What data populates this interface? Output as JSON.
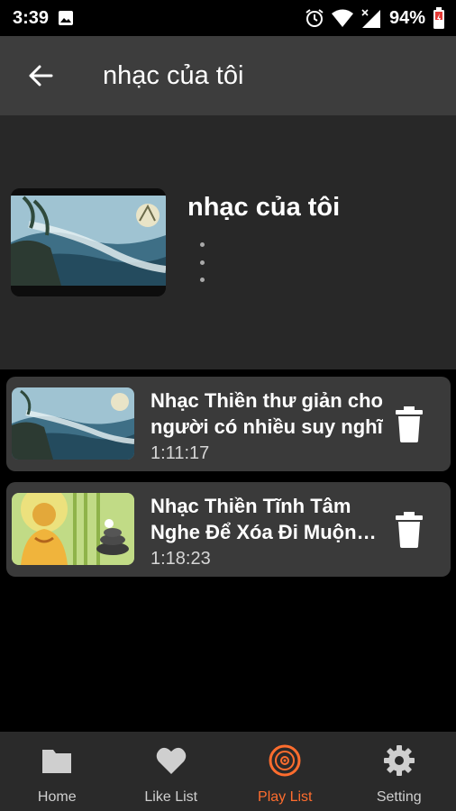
{
  "status_bar": {
    "time": "3:39",
    "battery": "94%"
  },
  "toolbar": {
    "title": "nhạc của tôi"
  },
  "playlist": {
    "name": "nhạc của tôi"
  },
  "songs": [
    {
      "title": "Nhạc Thiền thư giản cho người có nhiều suy nghĩ",
      "duration": "1:11:17"
    },
    {
      "title": "Nhạc Thiền Tĩnh Tâm Nghe Để Xóa Đi Muộn Phiền",
      "duration": "1:18:23"
    }
  ],
  "nav": {
    "items": [
      {
        "label": "Home",
        "icon": "folder-icon"
      },
      {
        "label": "Like List",
        "icon": "heart-icon"
      },
      {
        "label": "Play List",
        "icon": "disc-icon"
      },
      {
        "label": "Setting",
        "icon": "gear-icon"
      }
    ],
    "active": "Play List"
  },
  "colors": {
    "accent": "#ff6d2e",
    "toolbar": "#3d3d3d",
    "header": "#282828",
    "card": "#3a3a3a"
  }
}
